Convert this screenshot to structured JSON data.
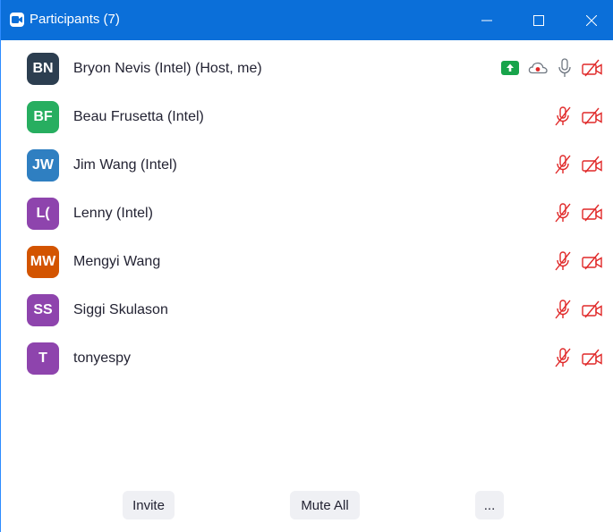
{
  "window": {
    "title": "Participants (7)"
  },
  "participants": [
    {
      "initials": "BN",
      "name": "Bryon Nevis (Intel) (Host, me)",
      "avatar_color": "#2c3e50",
      "is_host": true
    },
    {
      "initials": "BF",
      "name": "Beau Frusetta (Intel)",
      "avatar_color": "#27ae60",
      "is_host": false
    },
    {
      "initials": "JW",
      "name": "Jim Wang (Intel)",
      "avatar_color": "#2f7fc1",
      "is_host": false
    },
    {
      "initials": "L(",
      "name": "Lenny (Intel)",
      "avatar_color": "#8e44ad",
      "is_host": false
    },
    {
      "initials": "MW",
      "name": "Mengyi Wang",
      "avatar_color": "#d35400",
      "is_host": false
    },
    {
      "initials": "SS",
      "name": "Siggi Skulason",
      "avatar_color": "#8e44ad",
      "is_host": false
    },
    {
      "initials": "T",
      "name": "tonyespy",
      "avatar_color": "#8e44ad",
      "is_host": false
    }
  ],
  "icons": {
    "share": "screen-share-icon",
    "record": "cloud-record-icon",
    "mic": "microphone-icon",
    "mic_muted": "microphone-muted-icon",
    "video_off": "video-off-icon"
  },
  "colors": {
    "titlebar": "#0b6fd9",
    "muted_red": "#e02828",
    "share_green": "#18a44b"
  },
  "buttons": {
    "invite": "Invite",
    "mute_all": "Mute All",
    "more": "..."
  }
}
